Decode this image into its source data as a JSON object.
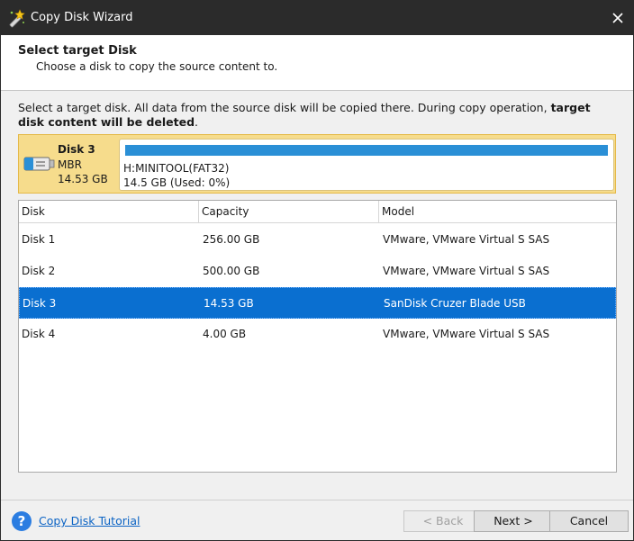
{
  "window": {
    "title": "Copy Disk Wizard"
  },
  "header": {
    "title": "Select target Disk",
    "subtitle": "Choose a disk to copy the source content to."
  },
  "description": {
    "text_plain": "Select a target disk. All data from the source disk will be copied there. During copy operation, ",
    "text_bold": "target disk content will be deleted",
    "text_end": "."
  },
  "selected_disk": {
    "name": "Disk 3",
    "type": "MBR",
    "size": "14.53 GB",
    "partition": {
      "label": "H:MINITOOL(FAT32)",
      "usage": "14.5 GB (Used: 0%)",
      "fill_fraction": 1.0
    }
  },
  "table": {
    "columns": [
      "Disk",
      "Capacity",
      "Model"
    ],
    "rows": [
      {
        "disk": "Disk 1",
        "capacity": "256.00 GB",
        "model": "VMware, VMware Virtual S SAS",
        "selected": false
      },
      {
        "disk": "Disk 2",
        "capacity": "500.00 GB",
        "model": "VMware, VMware Virtual S SAS",
        "selected": false
      },
      {
        "disk": "Disk 3",
        "capacity": "14.53 GB",
        "model": "SanDisk Cruzer Blade USB",
        "selected": true
      },
      {
        "disk": "Disk 4",
        "capacity": "4.00 GB",
        "model": "VMware, VMware Virtual S SAS",
        "selected": false
      }
    ]
  },
  "footer": {
    "tutorial_link": "Copy Disk Tutorial",
    "help_icon_glyph": "?",
    "back_label": "< Back",
    "next_label": "Next >",
    "cancel_label": "Cancel"
  },
  "colors": {
    "titlebar": "#2b2b2b",
    "selection": "#0a6fd0",
    "disk_card": "#f6dc8c",
    "partition_bar": "#2a8fd6",
    "link": "#0b63c4"
  }
}
